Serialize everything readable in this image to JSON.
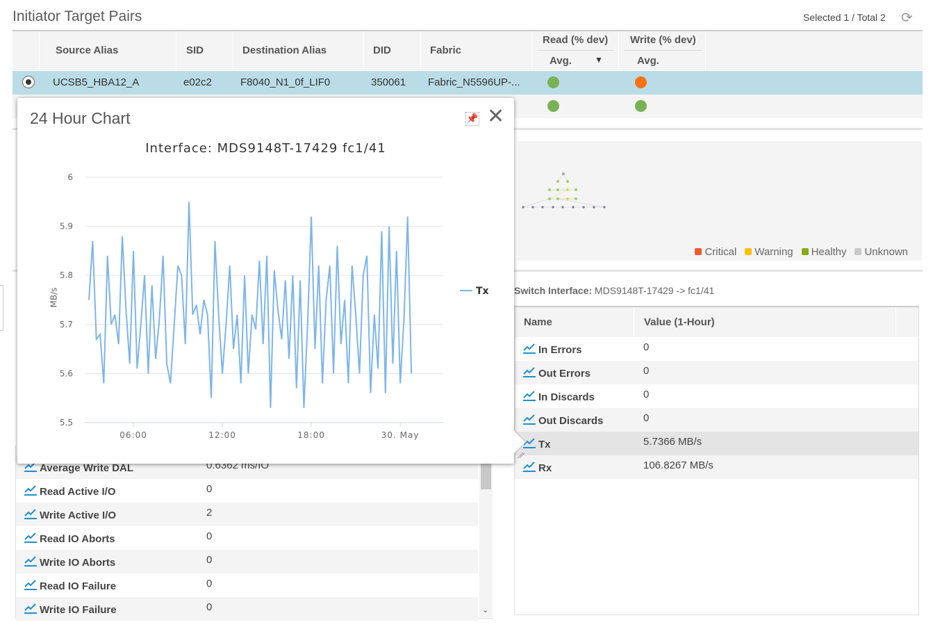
{
  "header": {
    "title": "Initiator Target Pairs",
    "selection": "Selected 1 / Total 2",
    "refresh_icon": "refresh-icon"
  },
  "table": {
    "columns": {
      "source_alias": "Source Alias",
      "sid": "SID",
      "destination_alias": "Destination Alias",
      "did": "DID",
      "fabric": "Fabric",
      "read": "Read (% dev)",
      "write": "Write (% dev)",
      "read_avg": "Avg.",
      "write_avg": "Avg."
    },
    "sort_indicator": "▼",
    "rows": [
      {
        "selected": true,
        "source_alias": "UCSB5_HBA12_A",
        "sid": "e02c2",
        "destination_alias": "F8040_N1_0f_LIF0",
        "did": "350061",
        "fabric": "Fabric_N5596UP-...",
        "read_status": "#77b255",
        "write_status": "#f57215"
      },
      {
        "selected": false,
        "source_alias": "",
        "sid": "",
        "destination_alias": "",
        "did": "",
        "fabric": "...",
        "read_status": "#77b255",
        "write_status": "#77b255"
      }
    ]
  },
  "topology": {
    "legend": [
      {
        "label": "Critical",
        "color": "#ee5a2c"
      },
      {
        "label": "Warning",
        "color": "#fcc000"
      },
      {
        "label": "Healthy",
        "color": "#8aa817"
      },
      {
        "label": "Unknown",
        "color": "#c8c8c8"
      }
    ]
  },
  "switch_interface": {
    "label": "Switch Interface:",
    "value": "MDS9148T-17429 -> fc1/41"
  },
  "interface_table": {
    "columns": {
      "name": "Name",
      "value": "Value (1-Hour)"
    },
    "rows": [
      {
        "name": "In Errors",
        "value": "0"
      },
      {
        "name": "Out Errors",
        "value": "0"
      },
      {
        "name": "In Discards",
        "value": "0"
      },
      {
        "name": "Out Discards",
        "value": "0"
      },
      {
        "name": "Tx",
        "value": "5.7366 MB/s",
        "highlighted": true
      },
      {
        "name": "Rx",
        "value": "106.8267 MB/s"
      }
    ]
  },
  "metrics_table": {
    "rows": [
      {
        "name": "Average Write DAL",
        "value": "0.6362 ms/IO"
      },
      {
        "name": "Read Active I/O",
        "value": "0"
      },
      {
        "name": "Write Active I/O",
        "value": "2"
      },
      {
        "name": "Read IO Aborts",
        "value": "0"
      },
      {
        "name": "Write IO Aborts",
        "value": "0"
      },
      {
        "name": "Read IO Failure",
        "value": "0"
      },
      {
        "name": "Write IO Failure",
        "value": "0"
      }
    ]
  },
  "popup": {
    "title": "24 Hour Chart",
    "pin_icon": "pin-icon",
    "close_icon": "close-icon"
  },
  "chart_data": {
    "type": "line",
    "title": "Interface: MDS9148T-17429 fc1/41",
    "ylabel": "MB/s",
    "ylim": [
      5.5,
      6
    ],
    "yticks": [
      "5.5",
      "5.6",
      "5.7",
      "5.8",
      "5.9",
      "6"
    ],
    "xlim": [
      "02:43",
      "02:54"
    ],
    "xticks": [
      {
        "label": "06:00",
        "time": "06:00"
      },
      {
        "label": "12:00",
        "time": "12:00"
      },
      {
        "label": "18:00",
        "time": "18:00"
      },
      {
        "label": "30. May",
        "time": "00:00"
      }
    ],
    "grid": true,
    "legend_position": "right",
    "series": [
      {
        "name": "Tx",
        "color": "#7cb5ec",
        "x": [
          "03:00",
          "03:15",
          "03:30",
          "03:45",
          "04:00",
          "04:15",
          "04:30",
          "04:45",
          "05:00",
          "05:15",
          "05:30",
          "05:45",
          "06:00",
          "06:15",
          "06:30",
          "06:45",
          "07:00",
          "07:15",
          "07:30",
          "07:45",
          "08:00",
          "08:15",
          "08:30",
          "08:45",
          "09:00",
          "09:15",
          "09:30",
          "09:45",
          "10:00",
          "10:15",
          "10:30",
          "10:45",
          "11:00",
          "11:15",
          "11:30",
          "11:45",
          "12:00",
          "12:15",
          "12:30",
          "12:45",
          "13:00",
          "13:15",
          "13:30",
          "13:45",
          "14:00",
          "14:15",
          "14:30",
          "14:45",
          "15:00",
          "15:15",
          "15:30",
          "15:45",
          "16:00",
          "16:15",
          "16:30",
          "16:45",
          "17:00",
          "17:15",
          "17:30",
          "17:45",
          "18:00",
          "18:15",
          "18:30",
          "18:45",
          "19:00",
          "19:15",
          "19:30",
          "19:45",
          "20:00",
          "20:15",
          "20:30",
          "20:45",
          "21:00",
          "21:15",
          "21:30",
          "21:45",
          "22:00",
          "22:15",
          "22:30",
          "22:45",
          "23:00",
          "23:15",
          "23:30",
          "23:45",
          "00:00",
          "00:15",
          "00:30",
          "00:45"
        ],
        "values": [
          5.75,
          5.87,
          5.67,
          5.68,
          5.58,
          5.84,
          5.7,
          5.72,
          5.66,
          5.88,
          5.73,
          5.62,
          5.85,
          5.61,
          5.7,
          5.8,
          5.6,
          5.78,
          5.63,
          5.71,
          5.84,
          5.62,
          5.58,
          5.7,
          5.82,
          5.8,
          5.66,
          5.95,
          5.72,
          5.74,
          5.68,
          5.75,
          5.72,
          5.55,
          5.87,
          5.72,
          5.6,
          5.7,
          5.82,
          5.65,
          5.72,
          5.58,
          5.8,
          5.6,
          5.72,
          5.69,
          5.83,
          5.66,
          5.84,
          5.53,
          5.81,
          5.73,
          5.67,
          5.79,
          5.63,
          5.8,
          5.57,
          5.79,
          5.53,
          5.7,
          5.92,
          5.65,
          5.82,
          5.58,
          5.75,
          5.82,
          5.6,
          5.86,
          5.66,
          5.75,
          5.58,
          5.82,
          5.72,
          5.6,
          5.8,
          5.84,
          5.56,
          5.72,
          5.61,
          5.89,
          5.56,
          5.9,
          5.62,
          5.85,
          5.58,
          5.71,
          5.92,
          5.6
        ]
      }
    ]
  }
}
